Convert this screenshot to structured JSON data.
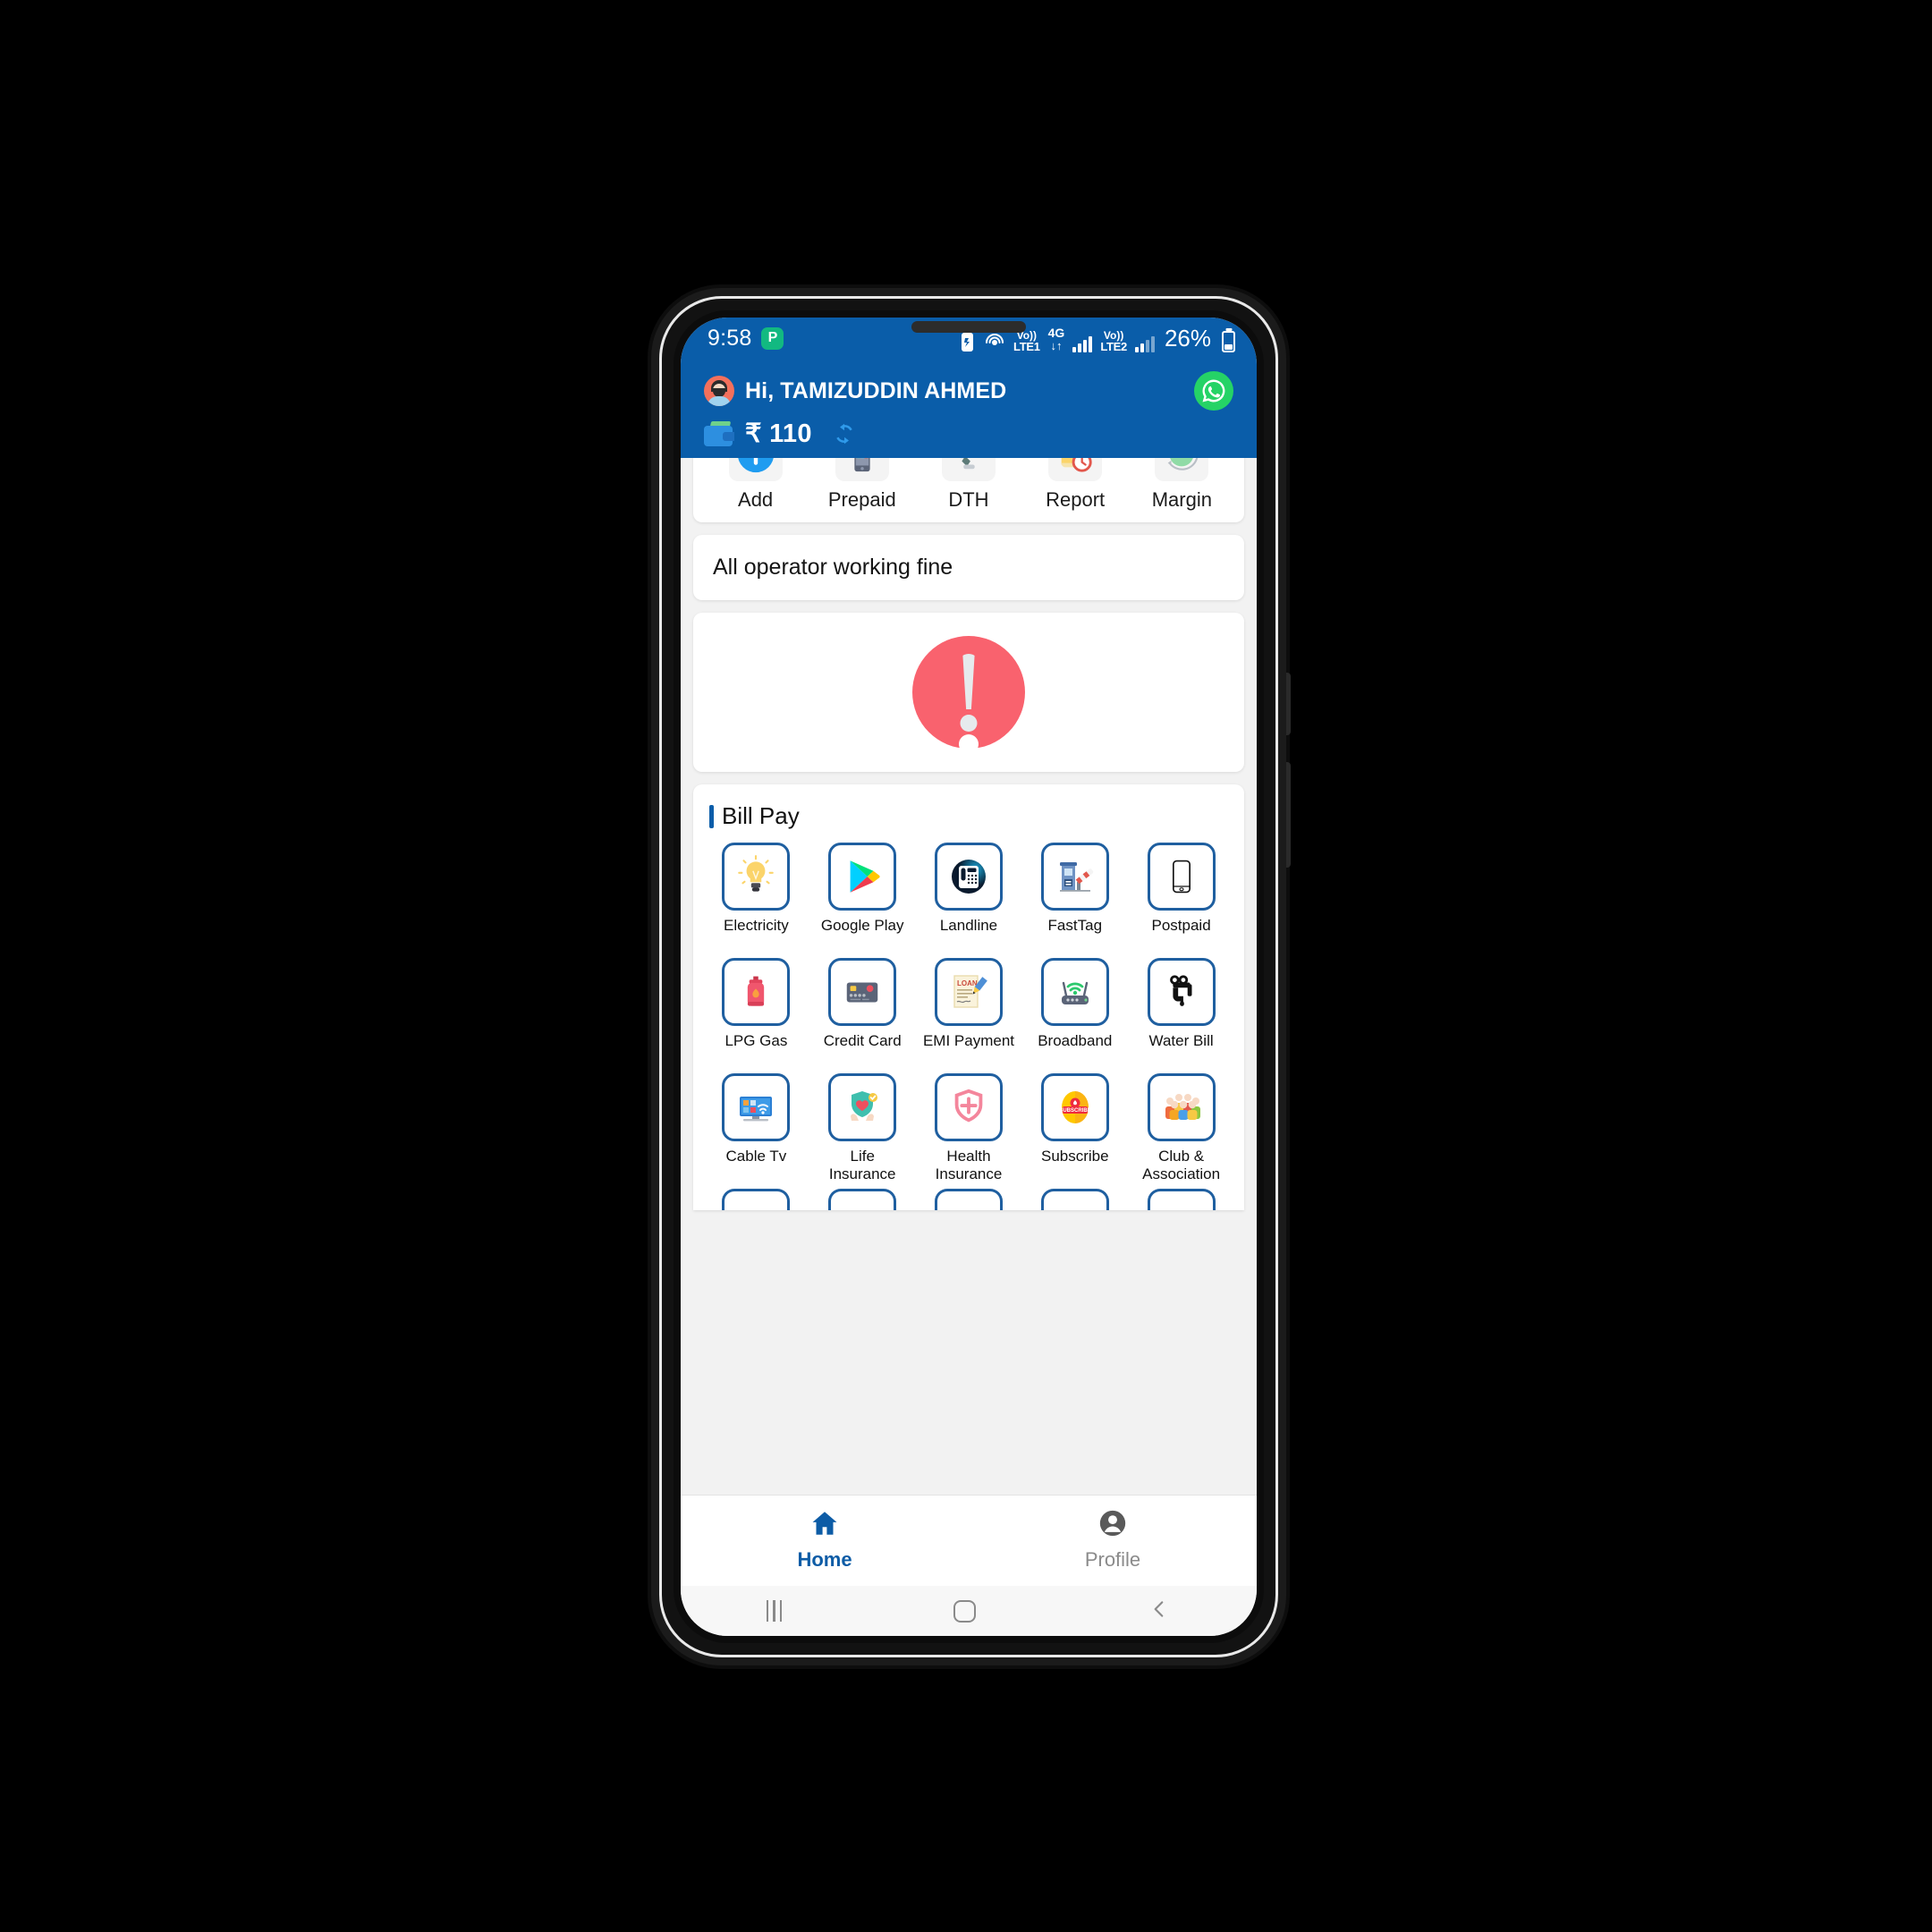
{
  "status_bar": {
    "time": "9:58",
    "app_badge": "P",
    "indicators": [
      "battery-saver-icon",
      "hotspot-icon"
    ],
    "volte1_top": "Vo))",
    "volte1_bottom": "LTE1",
    "network_top": "4G",
    "network_bottom": "↓↑",
    "volte2_top": "Vo))",
    "volte2_bottom": "LTE2",
    "battery_percent": "26%"
  },
  "header": {
    "greeting": "Hi, TAMIZUDDIN AHMED",
    "balance": "₹ 110",
    "whatsapp_label": "WhatsApp",
    "refresh_label": "Refresh balance",
    "bg_color": "#0a5da9"
  },
  "quick_actions": [
    {
      "label": "Add",
      "icon": "plus-circle-icon"
    },
    {
      "label": "Prepaid",
      "icon": "mobile-phone-icon"
    },
    {
      "label": "DTH",
      "icon": "satellite-dish-icon"
    },
    {
      "label": "Report",
      "icon": "report-scroll-clock-icon"
    },
    {
      "label": "Margin",
      "icon": "margin-pie-chart-icon"
    }
  ],
  "ticker": {
    "text": "All operator working fine"
  },
  "alert": {
    "icon": "exclamation-circle-icon",
    "color": "#f9626e"
  },
  "bill_pay": {
    "title": "Bill Pay",
    "accent_color": "#0a5da9",
    "tile_border_color": "#1f5fa0",
    "items": [
      {
        "label": "Electricity",
        "icon": "light-bulb-icon"
      },
      {
        "label": "Google Play",
        "icon": "google-play-icon"
      },
      {
        "label": "Landline",
        "icon": "landline-phone-icon"
      },
      {
        "label": "FastTag",
        "icon": "toll-barrier-icon"
      },
      {
        "label": "Postpaid",
        "icon": "smartphone-icon"
      },
      {
        "label": "LPG Gas",
        "icon": "gas-cylinder-icon"
      },
      {
        "label": "Credit Card",
        "icon": "credit-card-icon"
      },
      {
        "label": "EMI Payment",
        "icon": "loan-document-icon"
      },
      {
        "label": "Broadband",
        "icon": "wifi-router-icon"
      },
      {
        "label": "Water Bill",
        "icon": "water-tap-icon"
      },
      {
        "label": "Cable Tv",
        "icon": "smart-tv-icon"
      },
      {
        "label": "Life\nInsurance",
        "icon": "life-insurance-shield-icon"
      },
      {
        "label": "Health\nInsurance",
        "icon": "health-shield-icon"
      },
      {
        "label": "Subscribe",
        "icon": "subscribe-badge-icon"
      },
      {
        "label": "Club &\nAssociation",
        "icon": "group-people-icon"
      }
    ]
  },
  "bottom_nav": {
    "items": [
      {
        "label": "Home",
        "icon": "home-icon",
        "active": true
      },
      {
        "label": "Profile",
        "icon": "person-icon",
        "active": false
      }
    ],
    "active_color": "#0d5ca6",
    "inactive_color": "#8b8b8b"
  },
  "system_nav": {
    "recent_label": "Recent apps",
    "home_label": "Home",
    "back_label": "Back"
  }
}
